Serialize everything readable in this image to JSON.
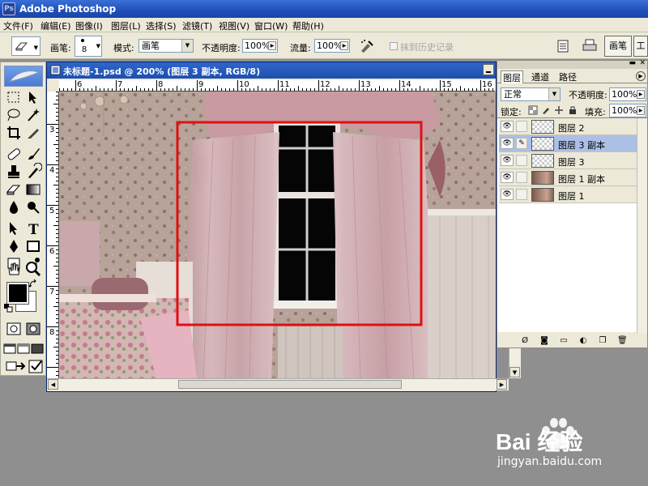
{
  "app": {
    "title": "Adobe Photoshop"
  },
  "menu": [
    "文件(F)",
    "编辑(E)",
    "图像(I)",
    "图层(L)",
    "选择(S)",
    "滤镜(T)",
    "视图(V)",
    "窗口(W)",
    "帮助(H)"
  ],
  "options": {
    "brush_label": "画笔:",
    "brush_size": "8",
    "mode_label": "模式:",
    "mode_value": "画笔",
    "opacity_label": "不透明度:",
    "opacity_value": "100%",
    "flow_label": "流量:",
    "flow_value": "100%",
    "erase_history_label": "抹到历史记录",
    "well_tab_1": "画笔",
    "well_tab_2": "工具预设"
  },
  "document": {
    "title": "未标题-1.psd @ 200% (图层 3 副本, RGB/8)",
    "h_ruler": [
      "6",
      "7",
      "8",
      "9",
      "10",
      "11",
      "12",
      "13",
      "14",
      "15",
      "16"
    ],
    "v_ruler": [
      "3",
      "4",
      "5",
      "6",
      "7",
      "8"
    ]
  },
  "layers_panel": {
    "tabs": [
      "图层",
      "通道",
      "路径"
    ],
    "blend_mode": "正常",
    "opacity_label": "不透明度:",
    "opacity_value": "100%",
    "lock_label": "锁定:",
    "fill_label": "填充:",
    "fill_value": "100%",
    "layers": [
      {
        "name": "图层 2",
        "selected": false,
        "thumb": "transparent"
      },
      {
        "name": "图层 3 副本",
        "selected": true,
        "thumb": "transparent"
      },
      {
        "name": "图层 3",
        "selected": false,
        "thumb": "transparent"
      },
      {
        "name": "图层 1 副本",
        "selected": false,
        "thumb": "image"
      },
      {
        "name": "图层 1",
        "selected": false,
        "thumb": "image"
      }
    ]
  },
  "watermark": {
    "brand": "Bai 经验",
    "url": "jingyan.baidu.com"
  },
  "colors": {
    "highlight_box": "#e01010",
    "selected_layer": "#acc0e6",
    "titlebar": "#1f4fb8"
  }
}
